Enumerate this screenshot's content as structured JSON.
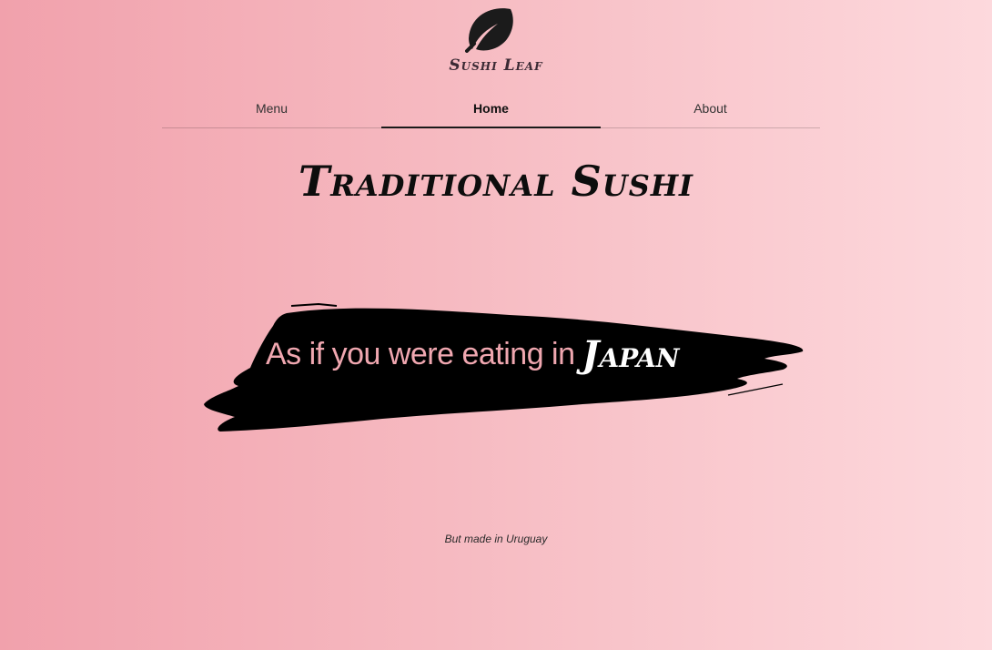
{
  "brand": {
    "logo_icon": "leaf-icon",
    "name": "Sushi Leaf"
  },
  "nav": {
    "tabs": [
      {
        "label": "Menu",
        "active": false
      },
      {
        "label": "Home",
        "active": true
      },
      {
        "label": "About",
        "active": false
      }
    ]
  },
  "hero": {
    "title": "Traditional Sushi",
    "tagline_main": "As if you were eating in",
    "tagline_accent": "Japan",
    "subtext": "But made in Uruguay"
  },
  "colors": {
    "background_start": "#f1a1ac",
    "background_end": "#fdd9dd",
    "tagline_pink": "#f0a7b0",
    "brush_black": "#000000",
    "text_dark": "#1a1a1a"
  }
}
